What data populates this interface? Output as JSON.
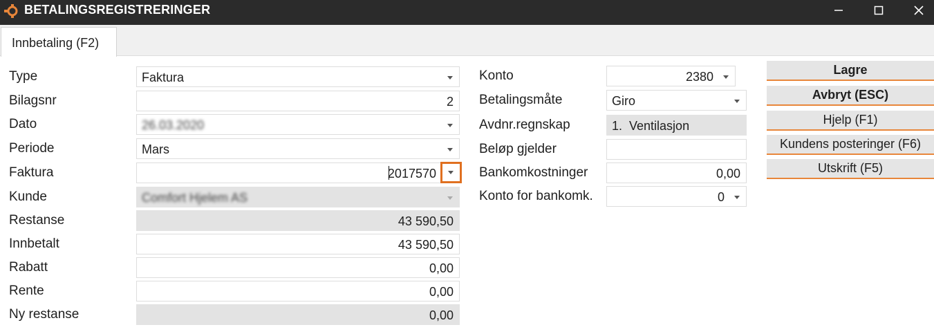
{
  "window": {
    "title": "BETALINGSREGISTRERINGER",
    "minimize_icon": "minimize-icon",
    "maximize_icon": "maximize-icon",
    "close_icon": "close-icon"
  },
  "tabs": [
    {
      "label": "Innbetaling (F2)",
      "active": true
    }
  ],
  "left_form": {
    "type": {
      "label": "Type",
      "value": "Faktura"
    },
    "bilagsnr": {
      "label": "Bilagsnr",
      "value": "2"
    },
    "dato": {
      "label": "Dato",
      "value": "26.03.2020"
    },
    "periode": {
      "label": "Periode",
      "value": "Mars"
    },
    "faktura": {
      "label": "Faktura",
      "value": "2017570"
    },
    "kunde": {
      "label": "Kunde",
      "value": "Comfort Hjelem AS"
    },
    "restanse": {
      "label": "Restanse",
      "value": "43 590,50"
    },
    "innbetalt": {
      "label": "Innbetalt",
      "value": "43 590,50"
    },
    "rabatt": {
      "label": "Rabatt",
      "value": "0,00"
    },
    "rente": {
      "label": "Rente",
      "value": "0,00"
    },
    "ny_restanse": {
      "label": "Ny restanse",
      "value": "0,00"
    }
  },
  "right_form": {
    "konto": {
      "label": "Konto",
      "value": "2380"
    },
    "betalingsmate": {
      "label": "Betalingsmåte",
      "value": "Giro"
    },
    "avdnr": {
      "label": "Avdnr.regnskap",
      "value": "1.  Ventilasjon"
    },
    "belop_gjelder": {
      "label": "Beløp gjelder",
      "value": ""
    },
    "bankomkostninger": {
      "label": "Bankomkostninger",
      "value": "0,00"
    },
    "konto_bankomk": {
      "label": "Konto for bankomk.",
      "value": "0"
    }
  },
  "buttons": {
    "lagre": "Lagre",
    "avbryt": "Avbryt (ESC)",
    "hjelp": "Hjelp (F1)",
    "kundens_posteringer": "Kundens posteringer (F6)",
    "utskrift": "Utskrift (F5)"
  },
  "colors": {
    "titlebar": "#2b2b2b",
    "accent": "#e07020",
    "readonly": "#e3e3e3"
  }
}
